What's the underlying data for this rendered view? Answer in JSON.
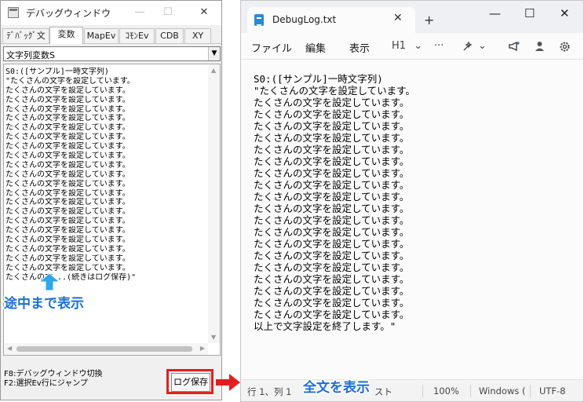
{
  "debug_window": {
    "title": "デバッグウィンドウ",
    "min_glyph": "—",
    "max_glyph": "☐",
    "close_glyph": "✕",
    "tabs": [
      {
        "label": "ﾃﾞﾊﾞｯｸﾞ文",
        "active": false
      },
      {
        "label": "変数",
        "active": true
      },
      {
        "label": "MapEv",
        "active": false
      },
      {
        "label": "ｺﾓﾝEv",
        "active": false
      },
      {
        "label": "CDB",
        "active": false
      },
      {
        "label": "XY",
        "active": false
      }
    ],
    "variable_select": {
      "value": "文字列変数S",
      "arrow": "▼"
    },
    "lines": [
      "S0:([サンプル]一時文字列)",
      "\"たくさんの文字を設定しています。",
      "たくさんの文字を設定しています。",
      "たくさんの文字を設定しています。",
      "たくさんの文字を設定しています。",
      "たくさんの文字を設定しています。",
      "たくさんの文字を設定しています。",
      "たくさんの文字を設定しています。",
      "たくさんの文字を設定しています。",
      "たくさんの文字を設定しています。",
      "たくさんの文字を設定しています。",
      "たくさんの文字を設定しています。",
      "たくさんの文字を設定しています。",
      "たくさんの文字を設定しています。",
      "たくさんの文字を設定しています。",
      "たくさんの文字を設定しています。",
      "たくさんの文字を設定しています。",
      "たくさんの文字を設定しています。",
      "たくさんの文字を設定しています。",
      "たくさんの文字を設定しています。",
      "たくさんの文字を設定しています。",
      "たくさんの文字を設定しています。",
      "たくさんの文...(続きはログ保存)\""
    ],
    "scroll": {
      "up": "▲",
      "down": "▼",
      "left": "◀",
      "right": "▶"
    },
    "status_line1": "F8:デバッグウィンドウ切換",
    "status_line2": "F2:選択Ev行にジャンプ",
    "save_log_label": "ログ保存"
  },
  "annotations": {
    "partial_label": "途中まで表示",
    "full_label": "全文を表示",
    "arrow_color": "#2ea8e8",
    "text_color": "#1c6fd8",
    "highlight_color": "#e02020"
  },
  "notepad": {
    "tab_title": "DebugLog.txt",
    "tab_close": "✕",
    "new_tab": "+",
    "window_min": "—",
    "window_max": "☐",
    "window_close": "✕",
    "menu": {
      "file": "ファイル",
      "edit": "編集",
      "view": "表示"
    },
    "toolbar": {
      "heading": "H1",
      "more": "···",
      "chevron": "⌄"
    },
    "lines": [
      "S0:([サンプル]一時文字列)",
      "\"たくさんの文字を設定しています。",
      "たくさんの文字を設定しています。",
      "たくさんの文字を設定しています。",
      "たくさんの文字を設定しています。",
      "たくさんの文字を設定しています。",
      "たくさんの文字を設定しています。",
      "たくさんの文字を設定しています。",
      "たくさんの文字を設定しています。",
      "たくさんの文字を設定しています。",
      "たくさんの文字を設定しています。",
      "たくさんの文字を設定しています。",
      "たくさんの文字を設定しています。",
      "たくさんの文字を設定しています。",
      "たくさんの文字を設定しています。",
      "たくさんの文字を設定しています。",
      "たくさんの文字を設定しています。",
      "たくさんの文字を設定しています。",
      "たくさんの文字を設定しています。",
      "たくさんの文字を設定しています。",
      "たくさんの文字を設定しています。",
      "以上で文字設定を終了します。\""
    ],
    "status": {
      "position": "行 1、列 1",
      "type": "スト",
      "zoom": "100%",
      "line_ending": "Windows (",
      "encoding": "UTF-8"
    }
  }
}
